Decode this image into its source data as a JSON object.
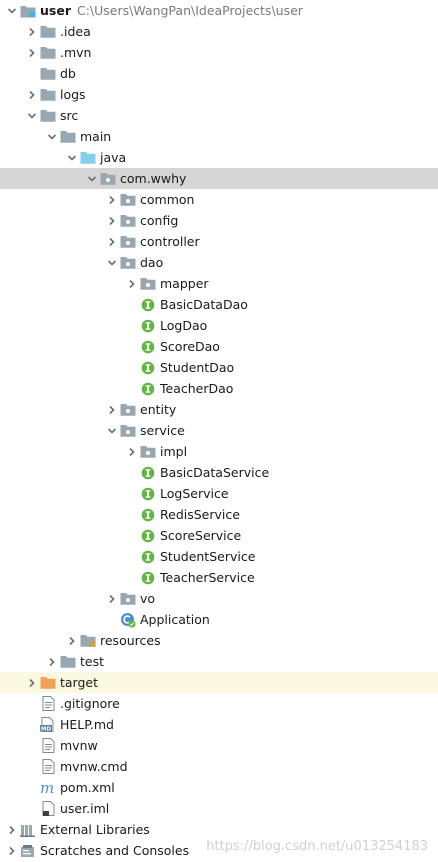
{
  "colors": {
    "folder": "#9aa7b0",
    "source_folder": "#87ceeb",
    "resources_folder": "#9aa7b0",
    "excluded_folder": "#f0a25a",
    "interface_badge": "#62b543",
    "selection": "#d5d5d5",
    "excluded_row": "#fbf8e2"
  },
  "tree": {
    "root": {
      "name": "user",
      "path": "C:\\Users\\WangPan\\IdeaProjects\\user"
    },
    "items": [
      {
        "label": ".idea",
        "depth": 1,
        "arrow": "right",
        "icon": "folder-icon"
      },
      {
        "label": ".mvn",
        "depth": 1,
        "arrow": "right",
        "icon": "folder-icon"
      },
      {
        "label": "db",
        "depth": 1,
        "arrow": "none",
        "icon": "folder-icon"
      },
      {
        "label": "logs",
        "depth": 1,
        "arrow": "right",
        "icon": "folder-icon"
      },
      {
        "label": "src",
        "depth": 1,
        "arrow": "down",
        "icon": "folder-icon"
      },
      {
        "label": "main",
        "depth": 2,
        "arrow": "down",
        "icon": "folder-icon"
      },
      {
        "label": "java",
        "depth": 3,
        "arrow": "down",
        "icon": "source-folder-icon"
      },
      {
        "label": "com.wwhy",
        "depth": 4,
        "arrow": "down",
        "icon": "package-icon",
        "selected": true
      },
      {
        "label": "common",
        "depth": 5,
        "arrow": "right",
        "icon": "package-icon"
      },
      {
        "label": "config",
        "depth": 5,
        "arrow": "right",
        "icon": "package-icon"
      },
      {
        "label": "controller",
        "depth": 5,
        "arrow": "right",
        "icon": "package-icon"
      },
      {
        "label": "dao",
        "depth": 5,
        "arrow": "down",
        "icon": "package-icon"
      },
      {
        "label": "mapper",
        "depth": 6,
        "arrow": "right",
        "icon": "package-icon"
      },
      {
        "label": "BasicDataDao",
        "depth": 6,
        "arrow": "none",
        "icon": "interface-icon"
      },
      {
        "label": "LogDao",
        "depth": 6,
        "arrow": "none",
        "icon": "interface-icon"
      },
      {
        "label": "ScoreDao",
        "depth": 6,
        "arrow": "none",
        "icon": "interface-icon"
      },
      {
        "label": "StudentDao",
        "depth": 6,
        "arrow": "none",
        "icon": "interface-icon"
      },
      {
        "label": "TeacherDao",
        "depth": 6,
        "arrow": "none",
        "icon": "interface-icon"
      },
      {
        "label": "entity",
        "depth": 5,
        "arrow": "right",
        "icon": "package-icon"
      },
      {
        "label": "service",
        "depth": 5,
        "arrow": "down",
        "icon": "package-icon"
      },
      {
        "label": "impl",
        "depth": 6,
        "arrow": "right",
        "icon": "package-icon"
      },
      {
        "label": "BasicDataService",
        "depth": 6,
        "arrow": "none",
        "icon": "interface-icon"
      },
      {
        "label": "LogService",
        "depth": 6,
        "arrow": "none",
        "icon": "interface-icon"
      },
      {
        "label": "RedisService",
        "depth": 6,
        "arrow": "none",
        "icon": "interface-icon"
      },
      {
        "label": "ScoreService",
        "depth": 6,
        "arrow": "none",
        "icon": "interface-icon"
      },
      {
        "label": "StudentService",
        "depth": 6,
        "arrow": "none",
        "icon": "interface-icon"
      },
      {
        "label": "TeacherService",
        "depth": 6,
        "arrow": "none",
        "icon": "interface-icon"
      },
      {
        "label": "vo",
        "depth": 5,
        "arrow": "right",
        "icon": "package-icon"
      },
      {
        "label": "Application",
        "depth": 5,
        "arrow": "none",
        "icon": "spring-boot-class-icon"
      },
      {
        "label": "resources",
        "depth": 3,
        "arrow": "right",
        "icon": "resources-folder-icon"
      },
      {
        "label": "test",
        "depth": 2,
        "arrow": "right",
        "icon": "folder-icon"
      },
      {
        "label": "target",
        "depth": 1,
        "arrow": "right",
        "icon": "excluded-folder-icon",
        "excluded": true
      },
      {
        "label": ".gitignore",
        "depth": 1,
        "arrow": "none",
        "icon": "text-file-icon"
      },
      {
        "label": "HELP.md",
        "depth": 1,
        "arrow": "none",
        "icon": "markdown-file-icon"
      },
      {
        "label": "mvnw",
        "depth": 1,
        "arrow": "none",
        "icon": "text-file-icon"
      },
      {
        "label": "mvnw.cmd",
        "depth": 1,
        "arrow": "none",
        "icon": "text-file-icon"
      },
      {
        "label": "pom.xml",
        "depth": 1,
        "arrow": "none",
        "icon": "maven-file-icon"
      },
      {
        "label": "user.iml",
        "depth": 1,
        "arrow": "none",
        "icon": "module-file-icon"
      },
      {
        "label": "External Libraries",
        "depth": 0,
        "arrow": "right",
        "icon": "libraries-icon"
      },
      {
        "label": "Scratches and Consoles",
        "depth": 0,
        "arrow": "right",
        "icon": "scratches-icon"
      }
    ]
  },
  "watermark": "https://blog.csdn.net/u013254183"
}
